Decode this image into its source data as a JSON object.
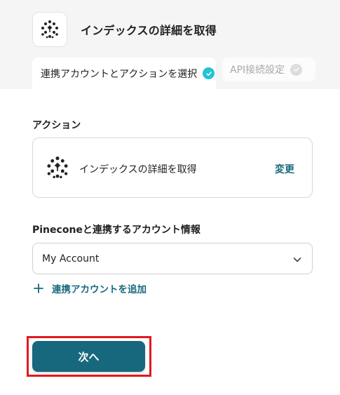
{
  "header": {
    "title": "インデックスの詳細を取得",
    "logo_icon": "pinecone-logo-icon"
  },
  "tabs": [
    {
      "label": "連携アカウントとアクションを選択",
      "status": "complete",
      "check_color": "#22c3d6"
    },
    {
      "label": "API接続設定",
      "status": "pending",
      "check_color": "#c8c8c8"
    }
  ],
  "action_section": {
    "label": "アクション",
    "action_name": "インデックスの詳細を取得",
    "change_label": "変更"
  },
  "account_section": {
    "label": "Pineconeと連携するアカウント情報",
    "selected_account": "My Account",
    "add_account_label": "連携アカウントを追加"
  },
  "footer": {
    "next_label": "次へ"
  },
  "colors": {
    "accent": "#17687c",
    "highlight": "#e3191f",
    "check_active": "#22c3d6"
  }
}
